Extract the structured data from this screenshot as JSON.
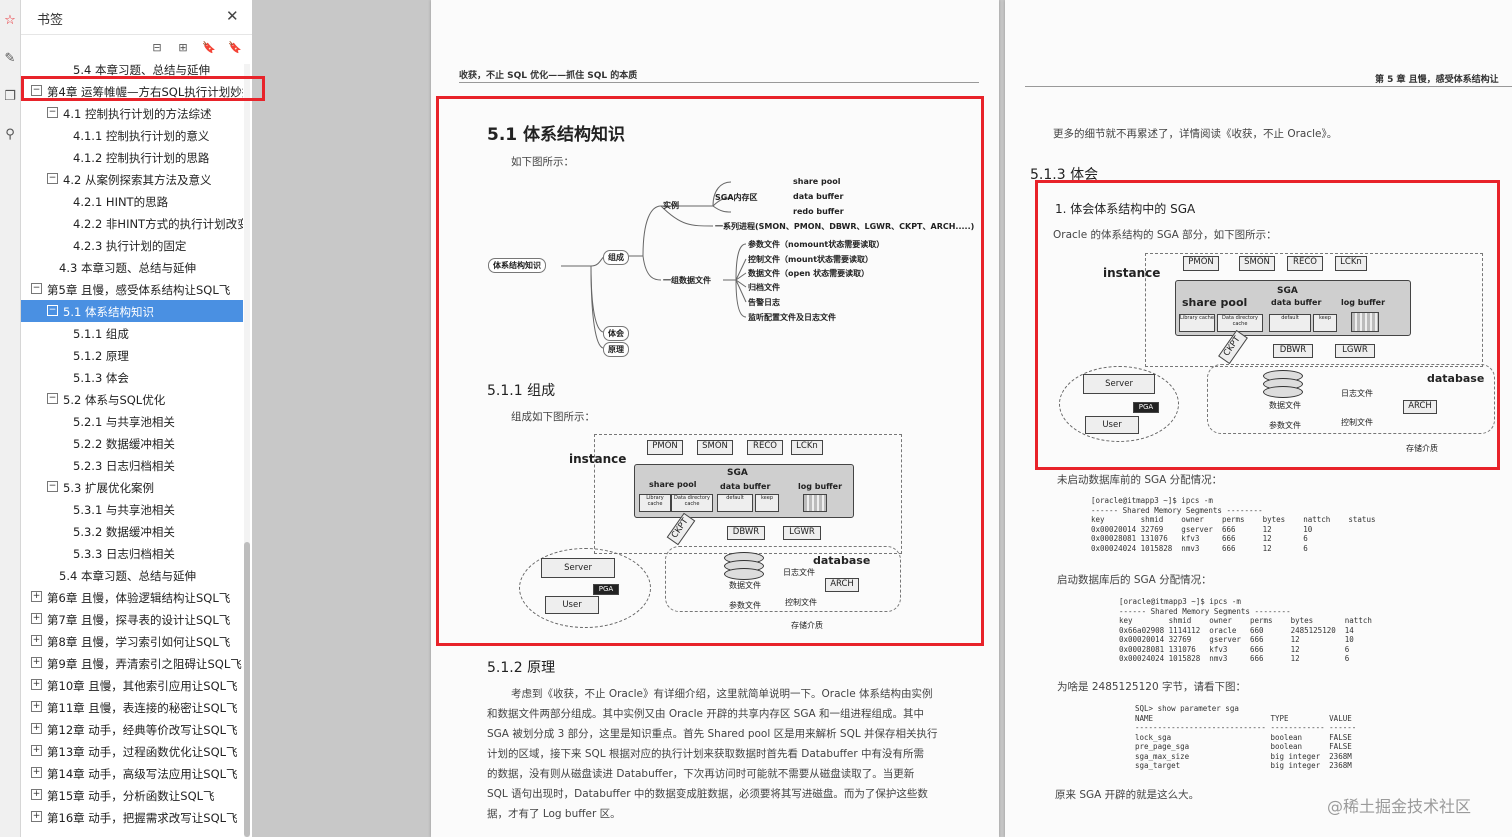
{
  "panel": {
    "title": "书签",
    "close": "✕",
    "tools": [
      "⊟",
      "⊞",
      "🔖",
      "🔖"
    ]
  },
  "tree": [
    {
      "label": "5.4 本章习题、总结与延伸",
      "level": 2,
      "toggle": ""
    },
    {
      "label": "第4章 运筹帷幄—方右SQL执行计划妙招",
      "level": 0,
      "toggle": "−"
    },
    {
      "label": "4.1 控制执行计划的方法综述",
      "level": 1,
      "toggle": "−"
    },
    {
      "label": "4.1.1 控制执行计划的意义",
      "level": 2,
      "toggle": ""
    },
    {
      "label": "4.1.2 控制执行计划的思路",
      "level": 2,
      "toggle": ""
    },
    {
      "label": "4.2 从案例探索其方法及意义",
      "level": 1,
      "toggle": "−"
    },
    {
      "label": "4.2.1 HINT的思路",
      "level": 2,
      "toggle": ""
    },
    {
      "label": "4.2.2 非HINT方式的执行计划改变",
      "level": 2,
      "toggle": ""
    },
    {
      "label": "4.2.3 执行计划的固定",
      "level": 2,
      "toggle": ""
    },
    {
      "label": "4.3 本章习题、总结与延伸",
      "level": 1.5,
      "toggle": ""
    },
    {
      "label": "第5章 且慢，感受体系结构让SQL飞",
      "level": 0,
      "toggle": "−"
    },
    {
      "label": "5.1 体系结构知识",
      "level": 1,
      "toggle": "−",
      "selected": true
    },
    {
      "label": "5.1.1 组成",
      "level": 2,
      "toggle": ""
    },
    {
      "label": "5.1.2 原理",
      "level": 2,
      "toggle": ""
    },
    {
      "label": "5.1.3 体会",
      "level": 2,
      "toggle": ""
    },
    {
      "label": "5.2 体系与SQL优化",
      "level": 1,
      "toggle": "−"
    },
    {
      "label": "5.2.1 与共享池相关",
      "level": 2,
      "toggle": ""
    },
    {
      "label": "5.2.2 数据缓冲相关",
      "level": 2,
      "toggle": ""
    },
    {
      "label": "5.2.3 日志归档相关",
      "level": 2,
      "toggle": ""
    },
    {
      "label": "5.3 扩展优化案例",
      "level": 1,
      "toggle": "−"
    },
    {
      "label": "5.3.1 与共享池相关",
      "level": 2,
      "toggle": ""
    },
    {
      "label": "5.3.2 数据缓冲相关",
      "level": 2,
      "toggle": ""
    },
    {
      "label": "5.3.3 日志归档相关",
      "level": 2,
      "toggle": ""
    },
    {
      "label": "5.4 本章习题、总结与延伸",
      "level": 1.5,
      "toggle": ""
    },
    {
      "label": "第6章 且慢，体验逻辑结构让SQL飞",
      "level": 0,
      "toggle": "+"
    },
    {
      "label": "第7章 且慢，探寻表的设计让SQL飞",
      "level": 0,
      "toggle": "+"
    },
    {
      "label": "第8章 且慢，学习索引如何让SQL飞",
      "level": 0,
      "toggle": "+"
    },
    {
      "label": "第9章 且慢，弄清索引之阻碍让SQL飞",
      "level": 0,
      "toggle": "+"
    },
    {
      "label": "第10章 且慢，其他索引应用让SQL飞",
      "level": 0,
      "toggle": "+"
    },
    {
      "label": "第11章 且慢，表连接的秘密让SQL飞",
      "level": 0,
      "toggle": "+"
    },
    {
      "label": "第12章 动手，经典等价改写让SQL飞",
      "level": 0,
      "toggle": "+"
    },
    {
      "label": "第13章 动手，过程函数优化让SQL飞",
      "level": 0,
      "toggle": "+"
    },
    {
      "label": "第14章 动手，高级写法应用让SQL飞",
      "level": 0,
      "toggle": "+"
    },
    {
      "label": "第15章 动手，分析函数让SQL飞",
      "level": 0,
      "toggle": "+"
    },
    {
      "label": "第16章 动手，把握需求改写让SQL飞",
      "level": 0,
      "toggle": "+"
    }
  ],
  "left_page": {
    "header": "收获，不止 SQL 优化——抓住 SQL 的本质",
    "h_51": "5.1   体系结构知识",
    "t_ru": "如下图所示：",
    "mindmap": {
      "root": "体系结构知识",
      "zucheng": "组成",
      "shili": "实例",
      "sga": "SGA内存区",
      "sga_items": [
        "share pool",
        "data buffer",
        "redo buffer"
      ],
      "procs": "一系列进程(SMON、PMON、DBWR、LGWR、CKPT、ARCH.....)",
      "files": "一组数据文件",
      "file_items": [
        "参数文件（nomount状态需要读取）",
        "控制文件（mount状态需要读取）",
        "数据文件（open 状态需要读取）",
        "归档文件",
        "告警日志",
        "监听配置文件及日志文件"
      ],
      "tihui": "体会",
      "yuanli": "原理"
    },
    "h_511": "5.1.1   组成",
    "t_zucheng": "组成如下图所示：",
    "h_512": "5.1.2   原理",
    "para": [
      "考虑到《收获，不止 Oracle》有详细介绍，这里就简单说明一下。Oracle 体系结构由实例",
      "和数据文件两部分组成。其中实例又由 Oracle 开辟的共享内存区 SGA 和一组进程组成。其中",
      "SGA 被划分成 3 部分，这里是知识重点。首先 Shared pool 区是用来解析 SQL 并保存相关执行",
      "计划的区域，接下来 SQL 根据对应的执行计划来获取数据时首先看 Databuffer 中有没有所需",
      "的数据，没有则从磁盘读进 Databuffer，下次再访问时可能就不需要从磁盘读取了。当更新",
      "SQL 语句出现时，Databuffer 中的数据变成脏数据，必须要将其写进磁盘。而为了保护这些数",
      "据，才有了 Log buffer 区。"
    ]
  },
  "arch": {
    "instance": "instance",
    "database": "database",
    "pmon": "PMON",
    "smon": "SMON",
    "reco": "RECO",
    "lckn": "LCKn",
    "sga": "SGA",
    "share_pool": "share pool",
    "data_buffer": "data buffer",
    "log_buffer": "log buffer",
    "lib": "Library cache",
    "dd": "Data directory cache",
    "default": "default",
    "keep": "keep",
    "dbwr": "DBWR",
    "lgwr": "LGWR",
    "ckpt": "CKPT",
    "server": "Server",
    "pga": "PGA",
    "user": "User",
    "datafile": "数据文件",
    "paramfile": "参数文件",
    "redolog": "日志文件",
    "ctlfile": "控制文件",
    "arch_p": "ARCH",
    "media": "存储介质"
  },
  "right_page": {
    "header": "第 5 章  且慢，感受体系结构让",
    "top_text": "更多的细节就不再累述了，详情阅读《收获，不止 Oracle》。",
    "h_513": "5.1.3   体会",
    "s1": "1. 体会体系结构中的 SGA",
    "s1_text": "Oracle 的体系结构的 SGA 部分，如下图所示：",
    "before": "未启动数据库前的 SGA 分配情况：",
    "code1": "[oracle@itmapp3 ~]$ ipcs -m\n------ Shared Memory Segments --------\nkey        shmid    owner    perms    bytes    nattch    status\n0x00020014 32769    gserver  666      12       10\n0x00028081 131076   kfv3     666      12       6\n0x00024024 1015828  nmv3     666      12       6",
    "after": "启动数据库后的 SGA 分配情况：",
    "code2": "[oracle@itmapp3 ~]$ ipcs -m\n------ Shared Memory Segments --------\nkey        shmid    owner    perms    bytes       nattch\n0x66a02908 1114112  oracle   660      2485125120  14\n0x00020014 32769    gserver  666      12          10\n0x00028081 131076   kfv3     666      12          6\n0x00024024 1015828  nmv3     666      12          6",
    "why": "为啥是 2485125120 字节，请看下图：",
    "code3": "SQL> show parameter sga\nNAME                          TYPE         VALUE\n----------------------------- ------------ ------\nlock_sga                      boolean      FALSE\npre_page_sga                  boolean      FALSE\nsga_max_size                  big integer  2368M\nsga_target                    big integer  2368M",
    "end": "原来 SGA 开辟的就是这么大。",
    "watermark": "@稀土掘金技术社区"
  },
  "colors": {
    "accent": "#e8232a",
    "selected": "#4a90e2"
  }
}
